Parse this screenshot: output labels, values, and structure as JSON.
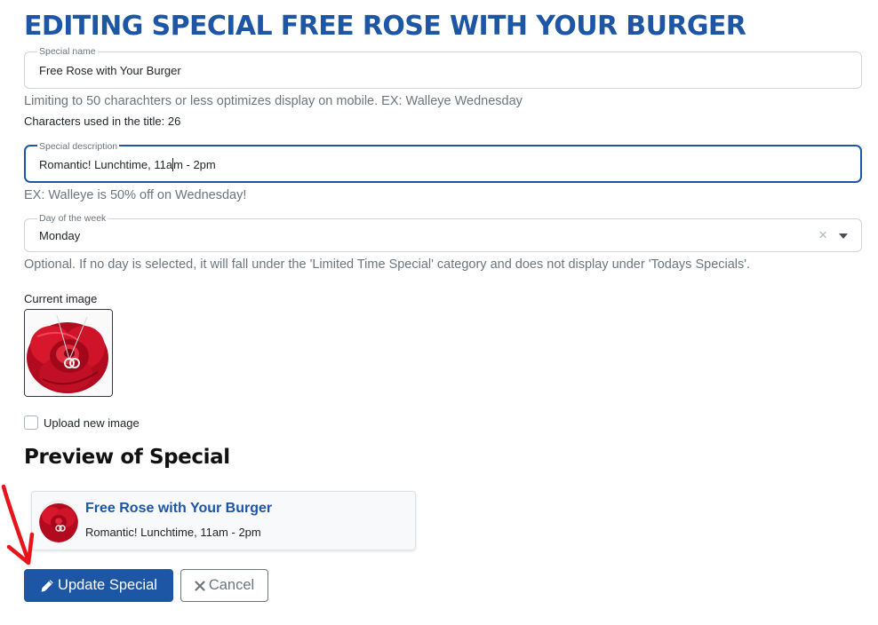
{
  "page": {
    "title": "EDITING SPECIAL FREE ROSE WITH YOUR BURGER"
  },
  "form": {
    "special_name": {
      "legend": "Special name",
      "value": "Free Rose with Your Burger",
      "help": "Limiting to 50 charachters or less optimizes display on mobile. EX: Walleye Wednesday",
      "char_count_label": "Characters used in the title: 26"
    },
    "special_description": {
      "legend": "Special description",
      "value_before_caret": "Romantic! Lunchtime, 11a",
      "value_after_caret": "m - 2pm",
      "help": "EX: Walleye is 50% off on Wednesday!"
    },
    "day_of_week": {
      "legend": "Day of the week",
      "value": "Monday",
      "clear_symbol": "×",
      "help": "Optional. If no day is selected, it will fall under the 'Limited Time Special' category and does not display under 'Todays Specials'."
    },
    "current_image_label": "Current image",
    "upload_new_image_label": "Upload new image",
    "upload_new_image_checked": false
  },
  "preview": {
    "heading": "Preview of Special",
    "title": "Free Rose with Your Burger",
    "description": "Romantic! Lunchtime, 11am - 2pm"
  },
  "actions": {
    "update_label": "Update Special",
    "update_icon": "pencil-icon",
    "cancel_label": "Cancel",
    "cancel_icon": "close-icon"
  },
  "colors": {
    "brand_blue": "#1d56a5",
    "annotation_red": "#e8141b",
    "rose_red": "#c8102e"
  }
}
